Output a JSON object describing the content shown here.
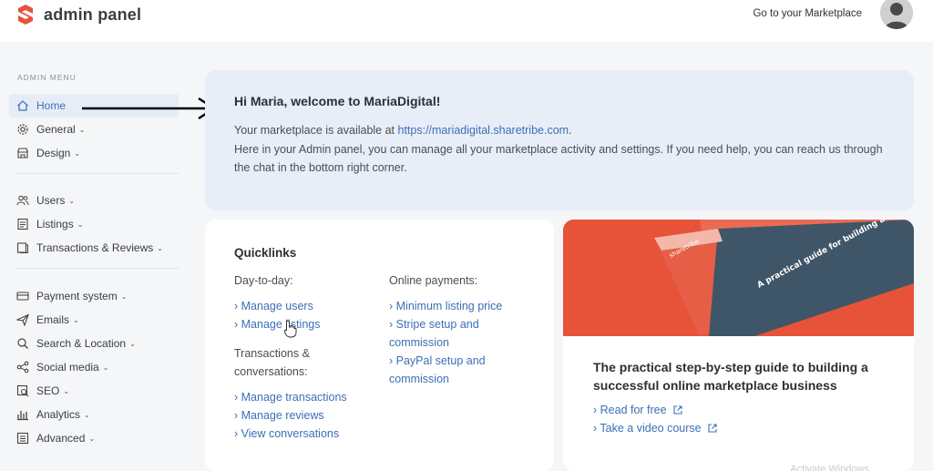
{
  "header": {
    "app_title": "admin panel",
    "marketplace_link": "Go to your Marketplace",
    "brand_color": "#e5533a"
  },
  "sidebar": {
    "heading": "ADMIN MENU",
    "items": [
      {
        "label": "Home",
        "icon": "home-icon"
      },
      {
        "label": "General",
        "icon": "gear-icon"
      },
      {
        "label": "Design",
        "icon": "store-icon"
      },
      {
        "label": "Users",
        "icon": "users-icon"
      },
      {
        "label": "Listings",
        "icon": "listings-icon"
      },
      {
        "label": "Transactions & Reviews",
        "icon": "transactions-icon"
      },
      {
        "label": "Payment system",
        "icon": "payment-icon"
      },
      {
        "label": "Emails",
        "icon": "send-icon"
      },
      {
        "label": "Search & Location",
        "icon": "search-icon"
      },
      {
        "label": "Social media",
        "icon": "share-icon"
      },
      {
        "label": "SEO",
        "icon": "seo-icon"
      },
      {
        "label": "Analytics",
        "icon": "analytics-icon"
      },
      {
        "label": "Advanced",
        "icon": "advanced-icon"
      }
    ]
  },
  "welcome": {
    "title": "Hi Maria, welcome to MariaDigital!",
    "line1_prefix": "Your marketplace is available at ",
    "line1_link": "https://mariadigital.sharetribe.com",
    "line1_suffix": ".",
    "line2": "Here in your Admin panel, you can manage all your marketplace activity and settings. If you need help, you can reach us through the chat in the bottom right corner."
  },
  "quicklinks": {
    "title": "Quicklinks",
    "day_to_day": {
      "label": "Day-to-day:",
      "links": [
        "› Manage users",
        "› Manage listings"
      ]
    },
    "transactions": {
      "label": "Transactions & conversations:",
      "links": [
        "› Manage transactions",
        "› Manage reviews",
        "› View conversations"
      ]
    },
    "payments": {
      "label": "Online payments:",
      "links": [
        "› Minimum listing price",
        "› Stripe setup and commission",
        "› PayPal setup and commission"
      ]
    }
  },
  "guide": {
    "title": "The practical step-by-step guide to building a successful online marketplace business",
    "read_link": "› Read for free",
    "video_link": "› Take a video course",
    "book_title": "A practical guide for building an online marketplace business",
    "book_brand": "sharetribe"
  },
  "watermark": "Activate Windows"
}
